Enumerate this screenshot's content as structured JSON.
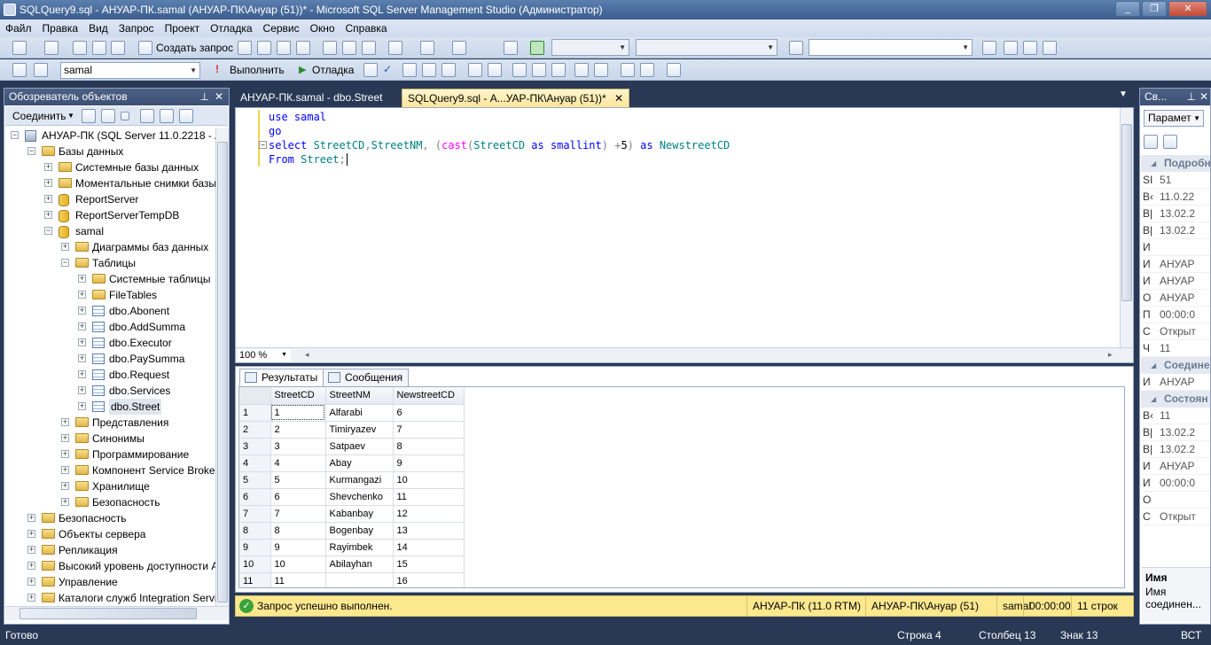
{
  "window": {
    "title": "SQLQuery9.sql - АНУАР-ПК.samal (АНУАР-ПК\\Ануар (51))* - Microsoft SQL Server Management Studio (Администратор)"
  },
  "menu": [
    "Файл",
    "Правка",
    "Вид",
    "Запрос",
    "Проект",
    "Отладка",
    "Сервис",
    "Окно",
    "Справка"
  ],
  "toolbar1": {
    "new_query": "Создать запрос"
  },
  "toolbar2": {
    "database": "samal",
    "execute": "Выполнить",
    "debug": "Отладка"
  },
  "object_explorer": {
    "title": "Обозреватель объектов",
    "connect": "Соединить",
    "nodes": [
      {
        "label": "АНУАР-ПК (SQL Server 11.0.2218 - АНУ",
        "level": 0,
        "icon": "server",
        "exp": "−"
      },
      {
        "label": "Базы данных",
        "level": 1,
        "icon": "folder",
        "exp": "−"
      },
      {
        "label": "Системные базы данных",
        "level": 2,
        "icon": "folder",
        "exp": "+"
      },
      {
        "label": "Моментальные снимки базы",
        "level": 2,
        "icon": "folder",
        "exp": "+"
      },
      {
        "label": "ReportServer",
        "level": 2,
        "icon": "db",
        "exp": "+"
      },
      {
        "label": "ReportServerTempDB",
        "level": 2,
        "icon": "db",
        "exp": "+"
      },
      {
        "label": "samal",
        "level": 2,
        "icon": "db",
        "exp": "−"
      },
      {
        "label": "Диаграммы баз данных",
        "level": 3,
        "icon": "folder",
        "exp": "+"
      },
      {
        "label": "Таблицы",
        "level": 3,
        "icon": "folder",
        "exp": "−"
      },
      {
        "label": "Системные таблицы",
        "level": 4,
        "icon": "folder",
        "exp": "+"
      },
      {
        "label": "FileTables",
        "level": 4,
        "icon": "folder",
        "exp": "+"
      },
      {
        "label": "dbo.Abonent",
        "level": 4,
        "icon": "table",
        "exp": "+"
      },
      {
        "label": "dbo.AddSumma",
        "level": 4,
        "icon": "table",
        "exp": "+"
      },
      {
        "label": "dbo.Executor",
        "level": 4,
        "icon": "table",
        "exp": "+"
      },
      {
        "label": "dbo.PaySumma",
        "level": 4,
        "icon": "table",
        "exp": "+"
      },
      {
        "label": "dbo.Request",
        "level": 4,
        "icon": "table",
        "exp": "+"
      },
      {
        "label": "dbo.Services",
        "level": 4,
        "icon": "table",
        "exp": "+"
      },
      {
        "label": "dbo.Street",
        "level": 4,
        "icon": "table",
        "exp": "+"
      },
      {
        "label": "Представления",
        "level": 3,
        "icon": "folder",
        "exp": "+"
      },
      {
        "label": "Синонимы",
        "level": 3,
        "icon": "folder",
        "exp": "+"
      },
      {
        "label": "Программирование",
        "level": 3,
        "icon": "folder",
        "exp": "+"
      },
      {
        "label": "Компонент Service Broker",
        "level": 3,
        "icon": "folder",
        "exp": "+"
      },
      {
        "label": "Хранилище",
        "level": 3,
        "icon": "folder",
        "exp": "+"
      },
      {
        "label": "Безопасность",
        "level": 3,
        "icon": "folder",
        "exp": "+"
      },
      {
        "label": "Безопасность",
        "level": 1,
        "icon": "folder",
        "exp": "+"
      },
      {
        "label": "Объекты сервера",
        "level": 1,
        "icon": "folder",
        "exp": "+"
      },
      {
        "label": "Репликация",
        "level": 1,
        "icon": "folder",
        "exp": "+"
      },
      {
        "label": "Высокий уровень доступности A",
        "level": 1,
        "icon": "folder",
        "exp": "+"
      },
      {
        "label": "Управление",
        "level": 1,
        "icon": "folder",
        "exp": "+"
      },
      {
        "label": "Каталоги служб Integration Servic",
        "level": 1,
        "icon": "folder",
        "exp": "+"
      }
    ]
  },
  "tabs": [
    {
      "label": "АНУАР-ПК.samal - dbo.Street"
    },
    {
      "label": "SQLQuery9.sql - А...УАР-ПК\\Ануар (51))*"
    }
  ],
  "editor": {
    "line1": {
      "kw": "use",
      "rest": " samal"
    },
    "line2": {
      "kw": "go"
    },
    "line3": {
      "kw1": "select",
      "cols": " StreetCD",
      "c1": ",",
      "cols2": "StreetNM",
      "c2": ",",
      "p1": " (",
      "fn": "cast",
      "p2": "(",
      "col3": "StreetCD",
      "as1": " as ",
      "type": "smallint",
      "p3": ")",
      "op": " +",
      "num": "5",
      "p4": ")",
      "as2": " as ",
      "alias": "NewstreetCD"
    },
    "line4": {
      "kw": "From",
      "rest": " Street",
      "semi": ";"
    },
    "zoom": "100 %"
  },
  "results": {
    "tab_results": "Результаты",
    "tab_messages": "Сообщения",
    "columns": [
      "StreetCD",
      "StreetNM",
      "NewstreetCD"
    ],
    "rows": [
      [
        "1",
        "1",
        "Alfarabi",
        "6"
      ],
      [
        "2",
        "2",
        "Timiryazev",
        "7"
      ],
      [
        "3",
        "3",
        "Satpaev",
        "8"
      ],
      [
        "4",
        "4",
        "Abay",
        "9"
      ],
      [
        "5",
        "5",
        "Kurmangazi",
        "10"
      ],
      [
        "6",
        "6",
        "Shevchenko",
        "11"
      ],
      [
        "7",
        "7",
        "Kabanbay",
        "12"
      ],
      [
        "8",
        "8",
        "Bogenbay",
        "13"
      ],
      [
        "9",
        "9",
        "Rayimbek",
        "14"
      ],
      [
        "10",
        "10",
        "Abilayhan",
        "15"
      ],
      [
        "11",
        "11",
        "",
        "16"
      ]
    ]
  },
  "query_status": {
    "message": "Запрос успешно выполнен.",
    "server": "АНУАР-ПК (11.0 RTM)",
    "user": "АНУАР-ПК\\Ануар (51)",
    "db": "samal",
    "time": "00:00:00",
    "rows": "11 строк"
  },
  "properties": {
    "title": "Св...",
    "combo": "Парамет",
    "cat1": "Подробн",
    "rows1": [
      [
        "SI",
        "51"
      ],
      [
        "В‹",
        "11.0.22"
      ],
      [
        "В|",
        "13.02.2"
      ],
      [
        "В|",
        "13.02.2"
      ],
      [
        "И",
        ""
      ],
      [
        "И",
        "АНУАР"
      ],
      [
        "И",
        "АНУАР"
      ],
      [
        "О",
        "АНУАР"
      ],
      [
        "П",
        "00:00:0"
      ],
      [
        "С",
        "Открыт"
      ],
      [
        "Ч",
        "11"
      ]
    ],
    "cat2": "Соедине",
    "rows2": [
      [
        "И",
        "АНУАР"
      ]
    ],
    "cat3": "Состоян",
    "rows3": [
      [
        "В‹",
        "11"
      ],
      [
        "В|",
        "13.02.2"
      ],
      [
        "В|",
        "13.02.2"
      ],
      [
        "И",
        "АНУАР"
      ],
      [
        "И",
        "00:00:0"
      ],
      [
        "О",
        ""
      ],
      [
        "С",
        "Открыт"
      ]
    ],
    "desc_title": "Имя",
    "desc_text": "Имя соединен..."
  },
  "statusbar": {
    "ready": "Готово",
    "line": "Строка 4",
    "col": "Столбец 13",
    "ch": "Знак 13",
    "mode": "ВСТ"
  }
}
